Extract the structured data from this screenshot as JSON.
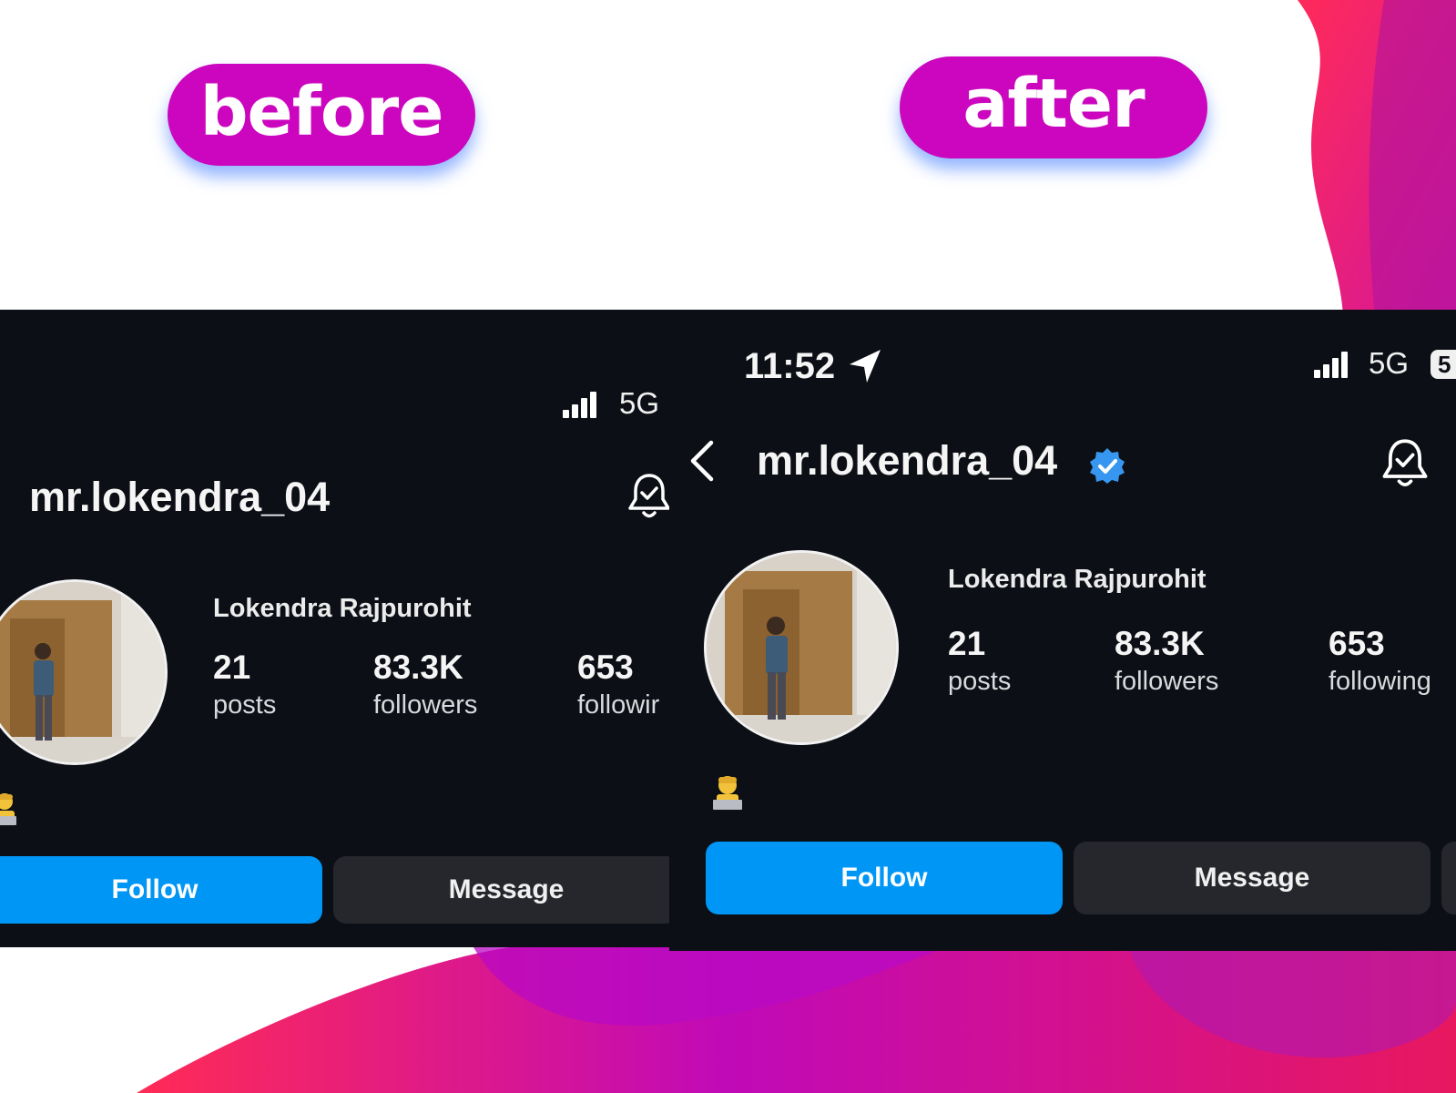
{
  "labels": {
    "before": "before",
    "after": "after"
  },
  "colors": {
    "pill": "#cc06be",
    "panel_bg": "#0c0f15",
    "follow_button": "#0096f5",
    "message_button": "#25272c",
    "verified_badge": "#3797f0"
  },
  "before": {
    "status": {
      "network": "5G"
    },
    "username": "mr.lokendra_04",
    "full_name": "Lokendra Rajpurohit",
    "stats": {
      "posts_count": "21",
      "posts_label": "posts",
      "followers_count": "83.3K",
      "followers_label": "followers",
      "following_count": "653",
      "following_label": "followir"
    },
    "buttons": {
      "follow": "Follow",
      "message": "Message"
    },
    "icons": [
      "signal-icon",
      "bell-icon",
      "avatar",
      "laptop-person-emoji-icon"
    ]
  },
  "after": {
    "status": {
      "time": "11:52",
      "network": "5G",
      "battery": "5"
    },
    "username": "mr.lokendra_04",
    "verified": true,
    "full_name": "Lokendra Rajpurohit",
    "stats": {
      "posts_count": "21",
      "posts_label": "posts",
      "followers_count": "83.3K",
      "followers_label": "followers",
      "following_count": "653",
      "following_label": "following"
    },
    "buttons": {
      "follow": "Follow",
      "message": "Message"
    },
    "icons": [
      "location-arrow-icon",
      "signal-icon",
      "battery-icon",
      "back-chevron-icon",
      "verified-badge-icon",
      "bell-icon",
      "avatar",
      "laptop-person-emoji-icon"
    ]
  }
}
